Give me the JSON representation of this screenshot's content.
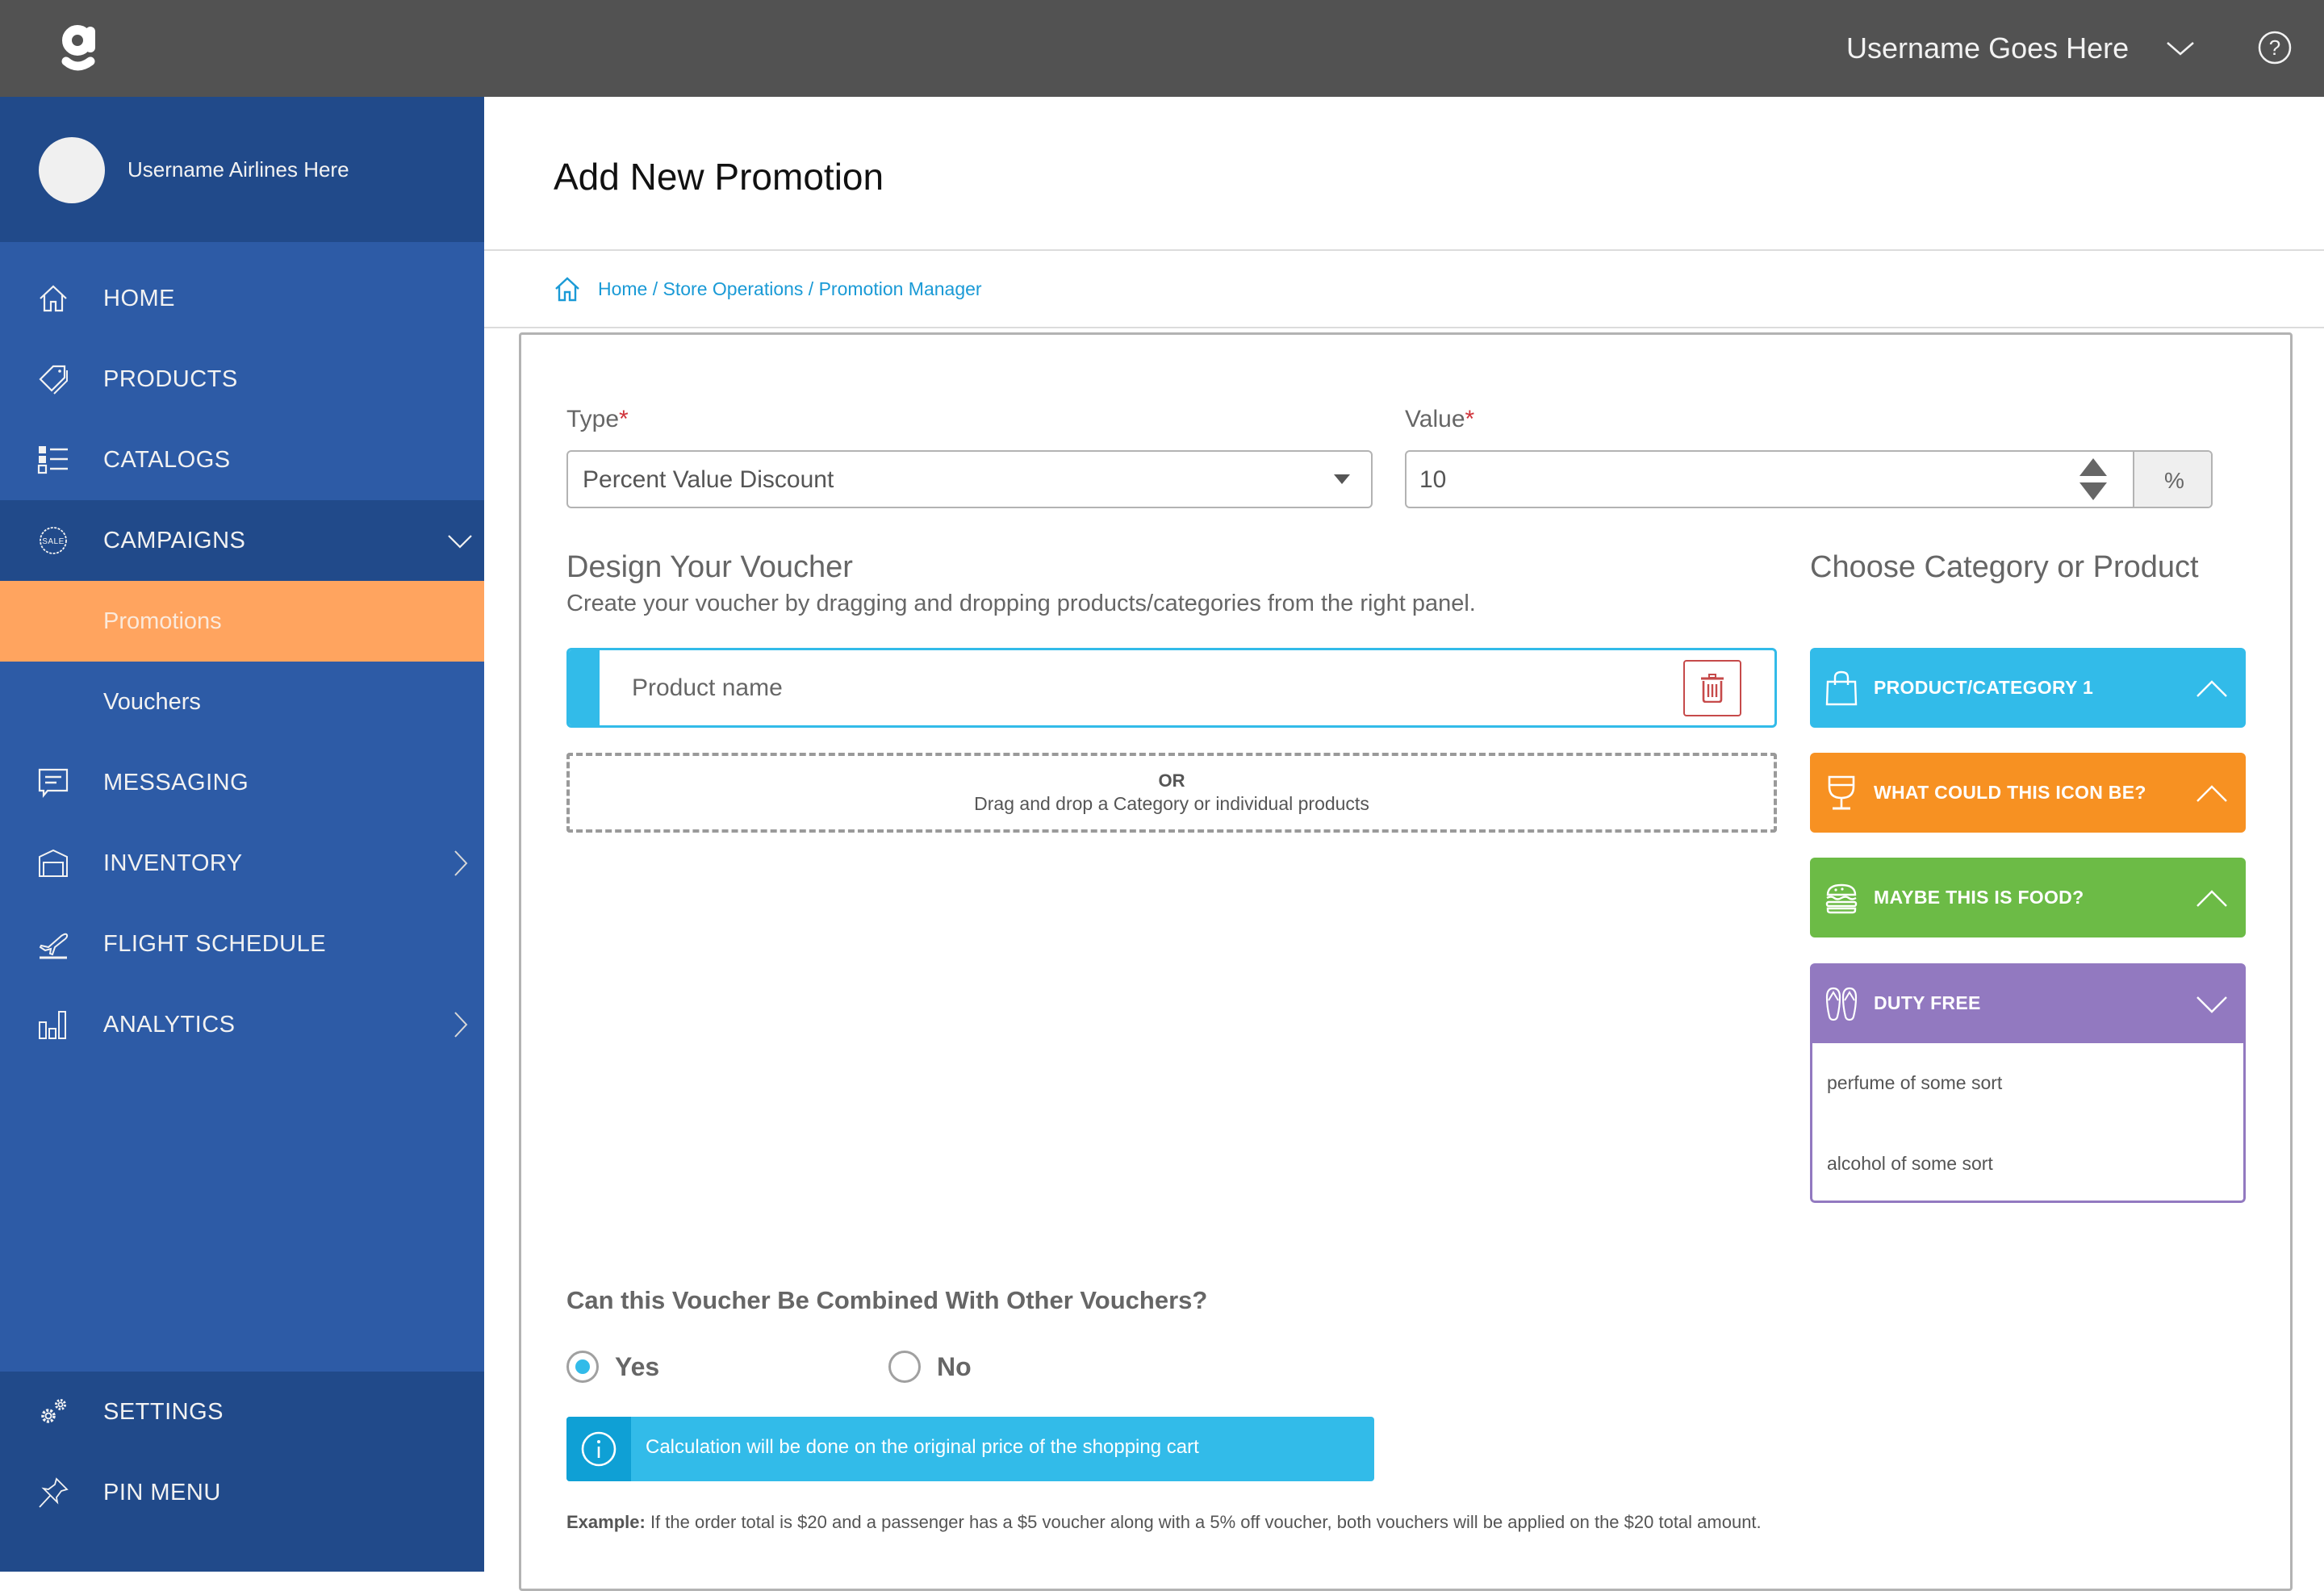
{
  "topbar": {
    "logo": "g-logo",
    "username": "Username Goes Here",
    "user_menu_icon": "chevron-down-icon",
    "help_icon": "help-circle-icon"
  },
  "sidebar": {
    "profile_name": "Username Airlines Here",
    "items": [
      {
        "label": "HOME",
        "icon": "home-icon"
      },
      {
        "label": "PRODUCTS",
        "icon": "tag-icon"
      },
      {
        "label": "CATALOGS",
        "icon": "list-icon"
      },
      {
        "label": "CAMPAIGNS",
        "icon": "sale-badge-icon",
        "expanded": true
      },
      {
        "label": "Promotions",
        "active": true
      },
      {
        "label": "Vouchers"
      },
      {
        "label": "MESSAGING",
        "icon": "message-icon"
      },
      {
        "label": "INVENTORY",
        "icon": "warehouse-icon",
        "has_children": true
      },
      {
        "label": "FLIGHT SCHEDULE",
        "icon": "plane-departure-icon"
      },
      {
        "label": "ANALYTICS",
        "icon": "bar-chart-icon",
        "has_children": true
      }
    ],
    "bottom_items": [
      {
        "label": "SETTINGS",
        "icon": "gears-icon"
      },
      {
        "label": "PIN MENU",
        "icon": "pushpin-icon"
      }
    ]
  },
  "page": {
    "title": "Add New Promotion",
    "breadcrumb": [
      "Home",
      "Store Operations",
      "Promotion Manager"
    ],
    "breadcrumb_separator": " / "
  },
  "form": {
    "type_label": "Type",
    "type_value": "Percent Value Discount",
    "value_label": "Value",
    "value_value": "10",
    "value_unit": "%",
    "required_mark": "*"
  },
  "designer": {
    "title": "Design Your Voucher",
    "subtitle": "Create your voucher by dragging and dropping products/categories from the right panel.",
    "product_row_label": "Product name",
    "dropzone_or": "OR",
    "dropzone_hint": "Drag and drop a Category or individual products"
  },
  "categories": {
    "title": "Choose Category or Product",
    "cards": [
      {
        "label": "PRODUCT/CATEGORY 1",
        "icon": "shopping-bag-icon",
        "color": "#32bbe9",
        "state": "collapsed"
      },
      {
        "label": "WHAT COULD THIS ICON BE?",
        "icon": "wine-glass-icon",
        "color": "#f79122",
        "state": "collapsed"
      },
      {
        "label": "MAYBE THIS IS FOOD?",
        "icon": "burger-icon",
        "color": "#6cbb46",
        "state": "collapsed"
      },
      {
        "label": "DUTY FREE",
        "icon": "flip-flops-icon",
        "color": "#9279c0",
        "state": "expanded",
        "items": [
          "perfume of some sort",
          "alcohol of some sort"
        ]
      }
    ]
  },
  "combine": {
    "question": "Can this Voucher Be Combined With Other Vouchers?",
    "options": [
      {
        "label": "Yes",
        "checked": true
      },
      {
        "label": "No",
        "checked": false
      }
    ],
    "info": "Calculation will be done on the original price of the shopping cart",
    "example_label": "Example:",
    "example_text": " If the order total is $20 and a passenger has a $5 voucher along with a 5% off voucher, both vouchers will be applied on the $20 total amount."
  },
  "colors": {
    "topbar": "#525252",
    "sidebar": "#2d5ba6",
    "sidebar_dark": "#214a8a",
    "active_item": "#ffa45f",
    "accent": "#32bbe9",
    "link": "#1a9ad6",
    "danger": "#c64a4a"
  }
}
